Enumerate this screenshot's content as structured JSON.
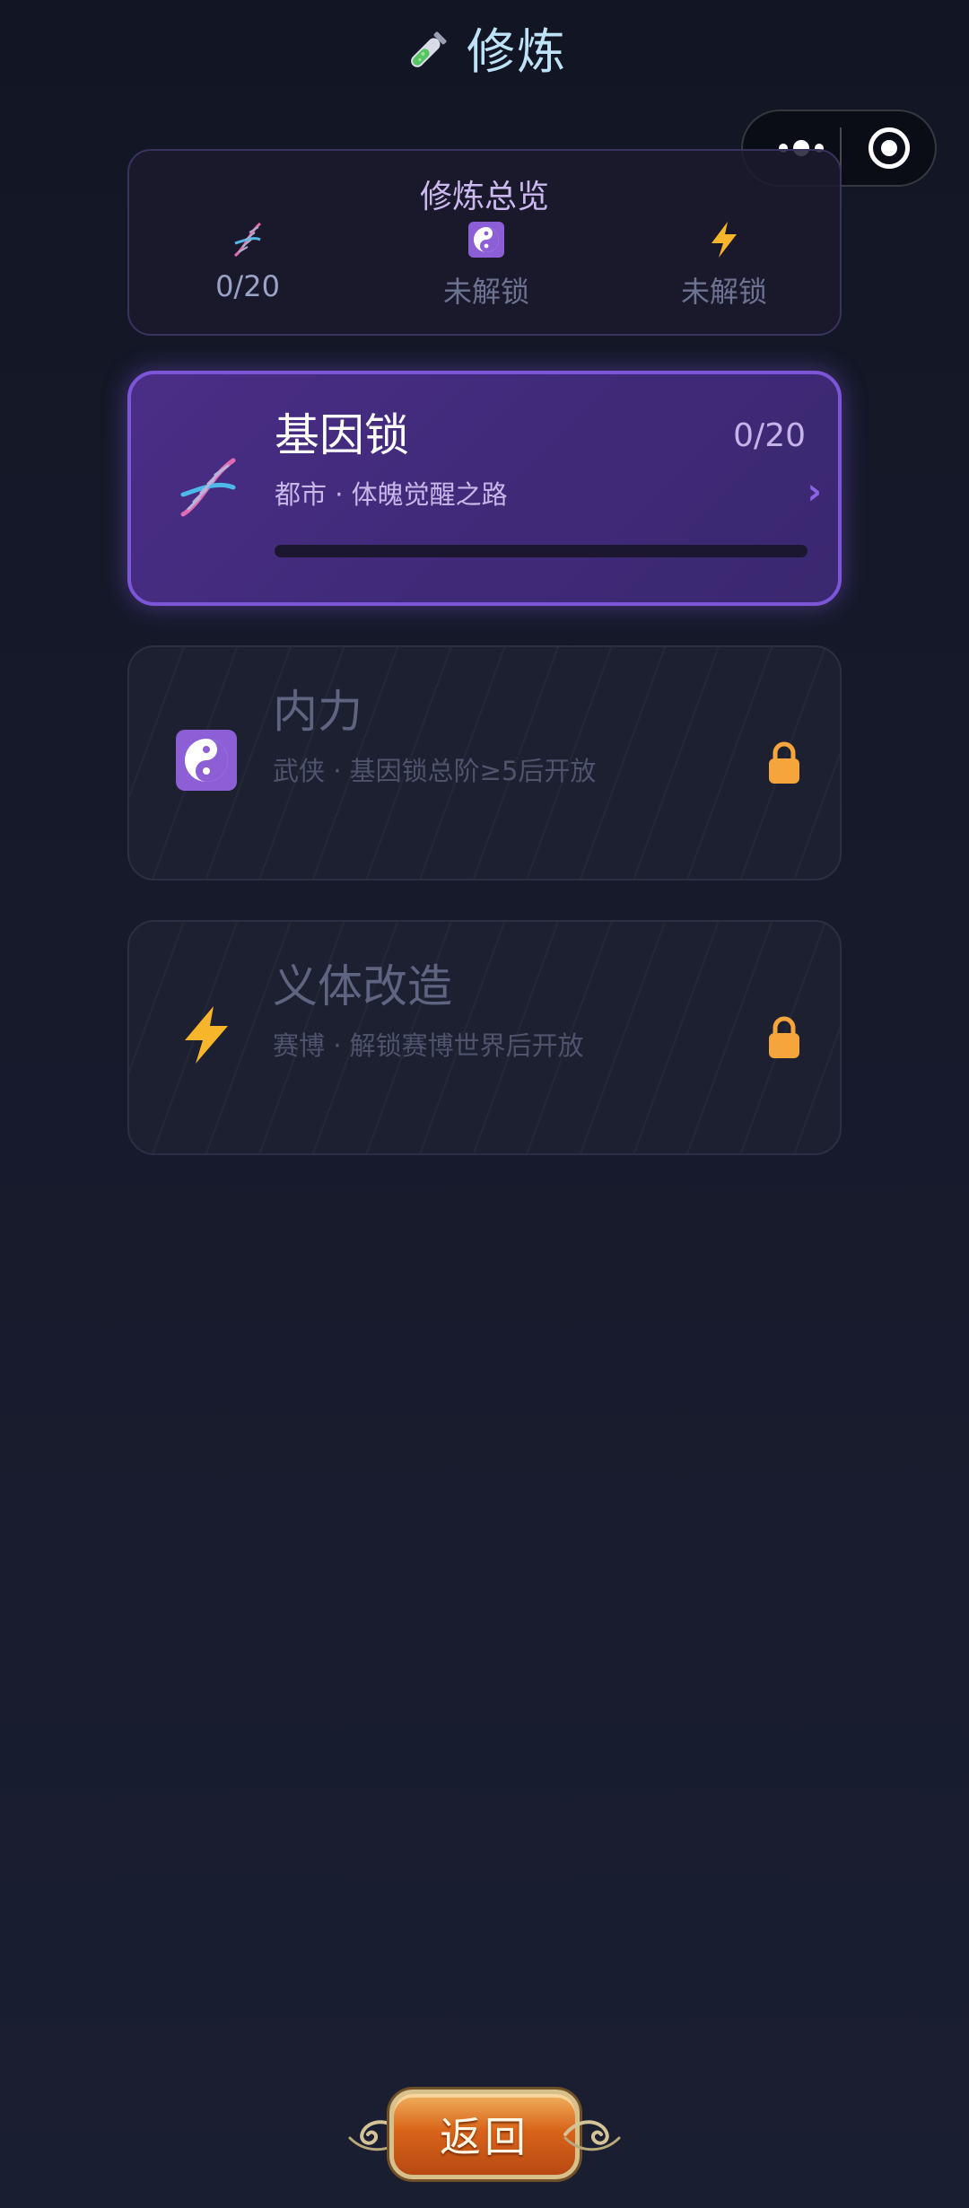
{
  "header": {
    "title": "修炼",
    "title_icon": "test-tube-icon"
  },
  "capsule": {
    "menu_icon": "more-dots-icon",
    "close_icon": "target-close-icon"
  },
  "overview": {
    "title": "修炼总览",
    "stats": [
      {
        "icon": "dna-icon",
        "value": "0/20"
      },
      {
        "icon": "yin-yang-icon",
        "value": "未解锁"
      },
      {
        "icon": "lightning-icon",
        "value": "未解锁"
      }
    ]
  },
  "cards": [
    {
      "name": "基因锁",
      "subtitle": "都市 · 体魄觉醒之路",
      "count": "0/20",
      "progress": 0,
      "icon": "dna-icon",
      "locked": false,
      "arrow": "›"
    },
    {
      "name": "内力",
      "subtitle": "武侠 · 基因锁总阶≥5后开放",
      "icon": "yin-yang-icon",
      "locked": true
    },
    {
      "name": "义体改造",
      "subtitle": "赛博 · 解锁赛博世界后开放",
      "icon": "lightning-icon",
      "locked": true
    }
  ],
  "back_button": {
    "label": "返回"
  },
  "colors": {
    "accent_purple": "#7d55d8",
    "lock_orange": "#f5a53c",
    "button_orange": "#d9641a"
  }
}
